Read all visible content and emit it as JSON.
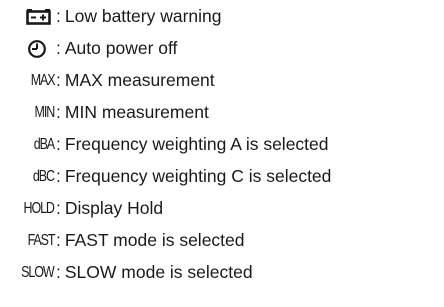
{
  "items": [
    {
      "symbol": "",
      "icon": "battery-low-icon",
      "text": "Low battery warning"
    },
    {
      "symbol": "",
      "icon": "auto-power-off-icon",
      "text": "Auto power off"
    },
    {
      "symbol": "MAX",
      "text": "MAX measurement"
    },
    {
      "symbol": "MIN",
      "text": "MIN measurement"
    },
    {
      "symbol": "dBA",
      "text": "Frequency weighting A is selected"
    },
    {
      "symbol": "dBC",
      "text": "Frequency weighting C is selected"
    },
    {
      "symbol": "HOLD",
      "text": "Display Hold"
    },
    {
      "symbol": "FAST",
      "text": "FAST mode is selected"
    },
    {
      "symbol": "SLOW",
      "text": "SLOW mode is selected"
    }
  ],
  "separator": ":"
}
